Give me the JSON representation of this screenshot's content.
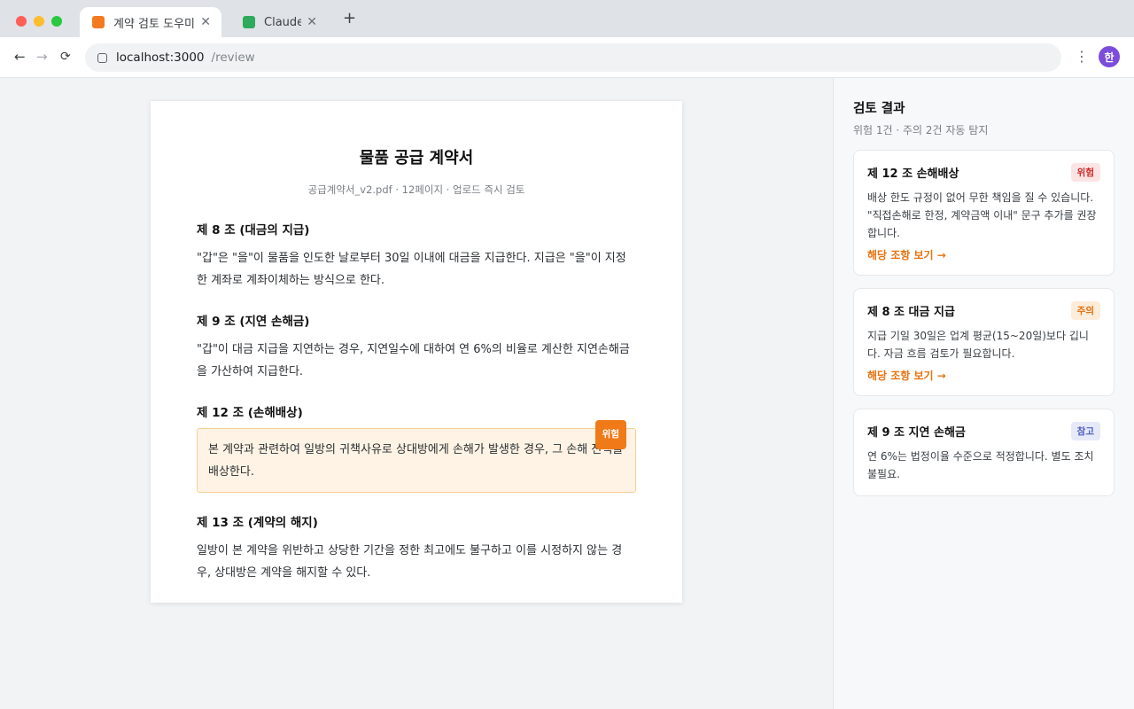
{
  "browser": {
    "tabs": [
      {
        "title": "계약 검토 도우미",
        "favicon_color": "#f47a1f",
        "active": true
      },
      {
        "title": "Claude",
        "favicon_color": "#2eaa5c",
        "active": false
      }
    ],
    "close_glyph": "✕",
    "new_tab_glyph": "+",
    "nav": {
      "back": "←",
      "forward": "→",
      "reload": "⟳"
    },
    "url_host": "localhost:3000",
    "url_path": "/review",
    "menu_glyph": "⋮",
    "avatar_initial": "한"
  },
  "document": {
    "title": "물품 공급 계약서",
    "meta": "공급계약서_v2.pdf · 12페이지 · 업로드 즉시 검토",
    "articles": [
      {
        "heading": "제 8 조 (대금의 지급)",
        "body": "\"갑\"은 \"을\"이 물품을 인도한 날로부터 30일 이내에 대금을 지급한다. 지급은 \"을\"이 지정한 계좌로 계좌이체하는 방식으로 한다."
      },
      {
        "heading": "제 9 조 (지연 손해금)",
        "body": "\"갑\"이 대금 지급을 지연하는 경우, 지연일수에 대하여 연 6%의 비율로 계산한 지연손해금을 가산하여 지급한다."
      },
      {
        "heading": "제 12 조 (손해배상)",
        "body": "본 계약과 관련하여 일방의 귀책사유로 상대방에게 손해가 발생한 경우, 그 손해 전액을 배상한다.",
        "badge": "위험"
      },
      {
        "heading": "제 13 조 (계약의 해지)",
        "body": "일방이 본 계약을 위반하고 상당한 기간을 정한 최고에도 불구하고 이를 시정하지 않는 경우, 상대방은 계약을 해지할 수 있다."
      }
    ]
  },
  "panel": {
    "title": "검토 결과",
    "subtitle": "위험 1건 · 주의 2건 자동 탐지",
    "cards": [
      {
        "title": "제 12 조 손해배상",
        "badge": "위험",
        "body": "배상 한도 규정이 없어 무한 책임을 질 수 있습니다. \"직접손해로 한정, 계약금액 이내\" 문구 추가를 권장합니다.",
        "link": "해당 조항 보기 →"
      },
      {
        "title": "제 8 조 대금 지급",
        "badge": "주의",
        "body": "지급 기일 30일은 업계 평균(15~20일)보다 깁니다. 자금 흐름 검토가 필요합니다.",
        "link": "해당 조항 보기 →"
      },
      {
        "title": "제 9 조 지연 손해금",
        "badge": "참고",
        "body": "연 6%는 법정이율 수준으로 적정합니다. 별도 조치 불필요."
      }
    ]
  }
}
